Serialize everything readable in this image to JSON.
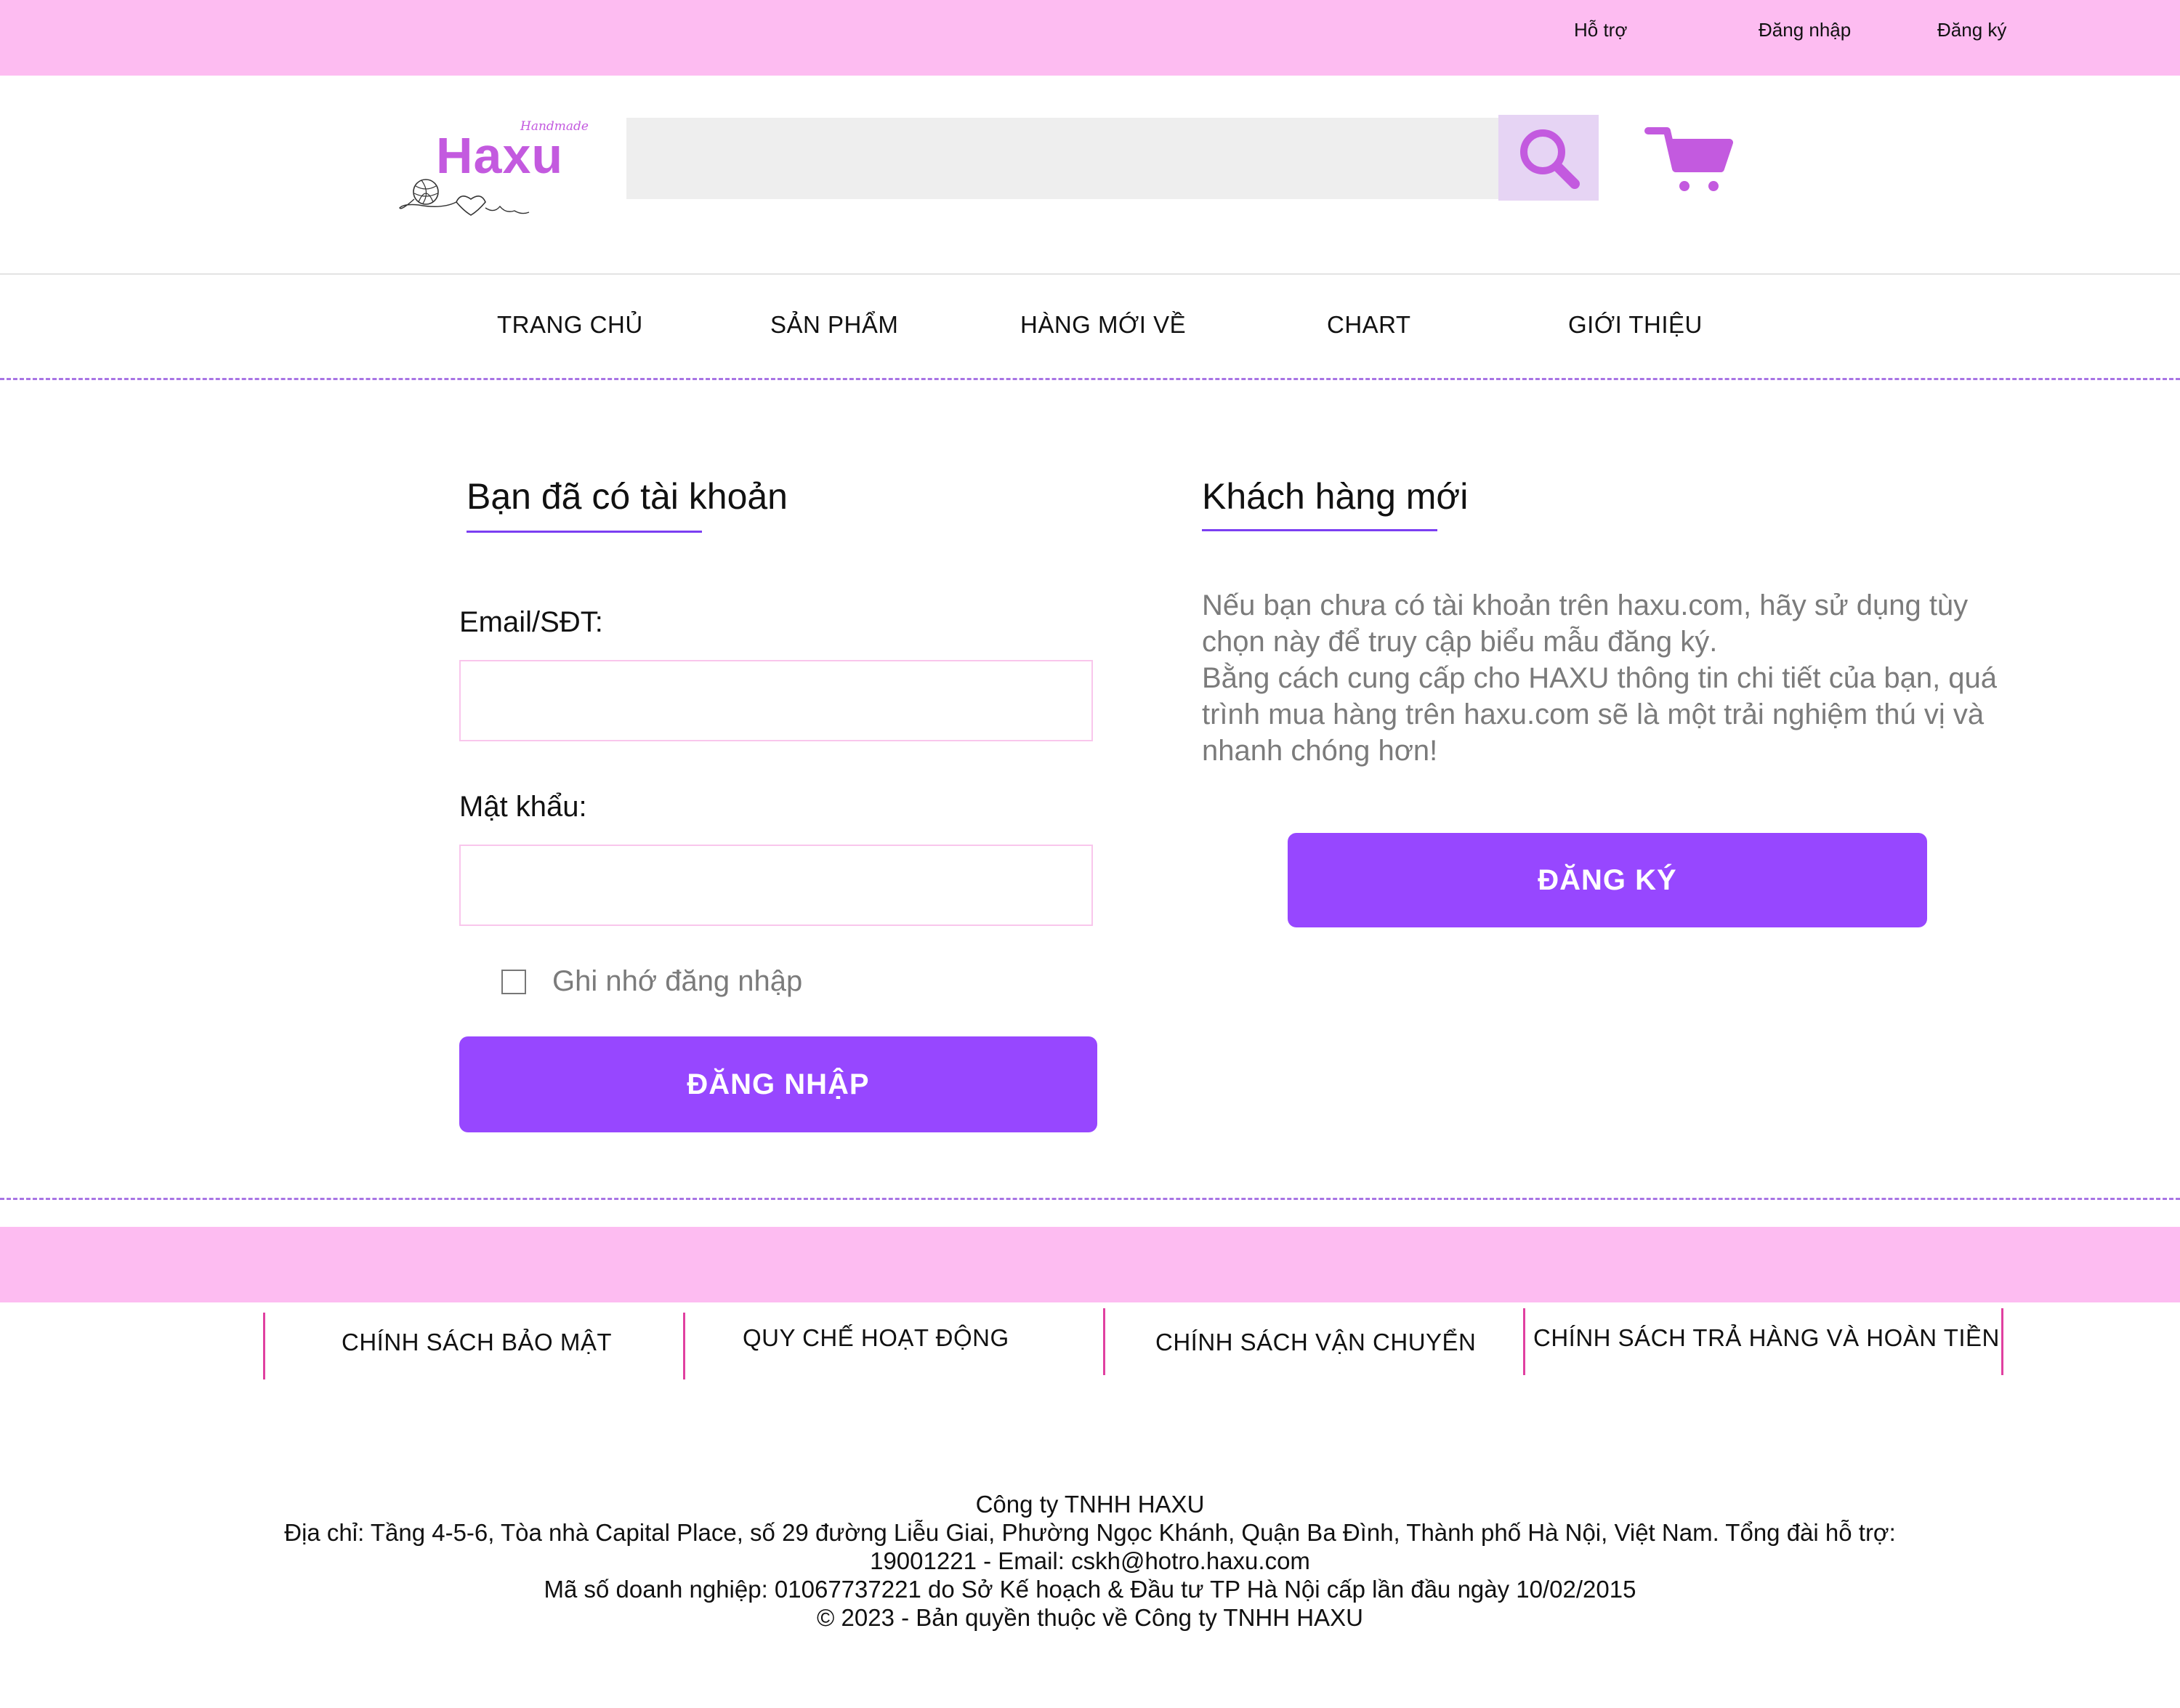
{
  "topbar": {
    "support": "Hỗ trợ",
    "login": "Đăng nhập",
    "register": "Đăng ký"
  },
  "header": {
    "logo_text": "Haxu",
    "logo_tagline": "Handmade",
    "search_placeholder": "",
    "accent_color": "#C35ADF"
  },
  "nav": {
    "items": [
      "TRANG CHỦ",
      "SẢN PHẨM",
      "HÀNG MỚI VỀ",
      "CHART",
      "GIỚI THIỆU"
    ]
  },
  "login_section": {
    "title": "Bạn đã có tài khoản",
    "email_label": "Email/SĐT:",
    "email_value": "",
    "password_label": "Mật khẩu:",
    "password_value": "",
    "remember_label": "Ghi nhớ đăng nhập",
    "remember_checked": false,
    "submit_label": "ĐĂNG NHẬP"
  },
  "register_section": {
    "title": "Khách hàng mới",
    "description_1": "Nếu bạn chưa có tài khoản trên haxu.com, hãy sử dụng tùy chọn này để truy cập biểu mẫu đăng ký.",
    "description_2": "Bằng cách cung cấp cho HAXU thông tin chi tiết của bạn, quá trình mua hàng trên haxu.com sẽ là một trải nghiệm thú vị và nhanh chóng hơn!",
    "submit_label": "ĐĂNG KÝ"
  },
  "footer": {
    "policies": [
      "CHÍNH SÁCH BẢO MẬT",
      "QUY CHẾ HOẠT ĐỘNG",
      "CHÍNH SÁCH VẬN CHUYỂN",
      "CHÍNH SÁCH TRẢ HÀNG VÀ HOÀN TIỀN"
    ],
    "company": "Công ty TNHH HAXU",
    "address_line1": "Địa chỉ: Tầng 4-5-6, Tòa nhà Capital Place, số 29 đường Liễu Giai, Phường Ngọc Khánh, Quận Ba Đình, Thành phố Hà Nội, Việt Nam. Tổng đài hỗ trợ:",
    "address_line2": "19001221 - Email: cskh@hotro.haxu.com",
    "business_id": "Mã số doanh nghiệp: 01067737221 do Sở Kế hoạch & Đầu tư TP Hà Nội cấp lần đầu ngày 10/02/2015",
    "copyright": "© 2023 - Bản quyền thuộc về Công ty TNHH HAXU"
  },
  "colors": {
    "pink_band": "#FDBCF1",
    "primary_button": "#9747FF",
    "dashed_divider": "#A874E4",
    "search_button_bg": "#E6D4F4"
  },
  "icons": [
    "search-icon",
    "cart-icon",
    "yarn-ball-icon",
    "checkbox-icon"
  ]
}
